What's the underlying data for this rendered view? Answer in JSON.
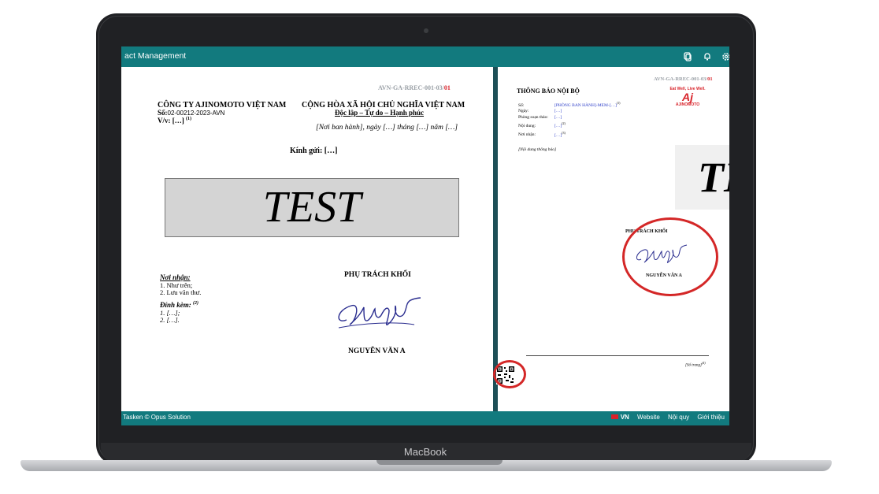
{
  "app": {
    "title": "act Management",
    "icons": [
      "copy-icon",
      "bell-icon",
      "gear-icon"
    ]
  },
  "footer": {
    "left": "Tasken © Opus Solution",
    "lang": "VN",
    "links": [
      "Website",
      "Nội quy",
      "Giới thiệu"
    ]
  },
  "laptop": {
    "brand": "MacBook"
  },
  "doc_left": {
    "code": "AVN-GA-RREC-001-03/",
    "code_suffix": "01",
    "company": "CÔNG TY AJINOMOTO VIỆT NAM",
    "so_label": "Số:",
    "so_value": "02-00212-2023-AVN",
    "vv": "V/v: […]",
    "vv_sup": "(1)",
    "republic": "CỘNG HÒA XÃ HỘI CHỦ NGHĨA VIỆT NAM",
    "motto": "Độc lập – Tự do – Hạnh phúc",
    "place_date": "[Nơi ban hành], ngày […] tháng […] năm […]",
    "greeting": "Kính gửi: […]",
    "watermark": "TEST",
    "recipients_label": "Nơi nhận:",
    "recipients": [
      "1.  Như trên;",
      "2.  Lưu văn thư."
    ],
    "attach_label": "Đính kèm:",
    "attach_sup": "(2)",
    "attachments": [
      "1.  […];",
      "2.  […]."
    ],
    "signer_title": "PHỤ TRÁCH KHỐI",
    "signer_name": "NGUYỄN VĂN A"
  },
  "doc_right": {
    "code": "AVN-GA-RREC-001-03/",
    "code_suffix": "01",
    "heading": "THÔNG BÁO NỘI BỘ",
    "logo_tagline": "Eat Well, Live Well.",
    "logo_brand": "AJINOMOTO",
    "fields": [
      {
        "label": "Số:",
        "value": "[PHÒNG BAN HÀNH]-MEM-[…]",
        "sup": "(1)"
      },
      {
        "label": "Ngày:",
        "value": "[…]",
        "sup": ""
      },
      {
        "label": "Phòng soạn thảo:",
        "value": "[…]",
        "sup": ""
      },
      {
        "label": "Nội dung:",
        "value": "[…]",
        "sup": "(2)"
      },
      {
        "label": "Nơi nhận:",
        "value": "[…]",
        "sup": "(3)"
      }
    ],
    "content_placeholder": "[Nội dung thông báo]",
    "watermark": "TEST",
    "signer_title": "PHỤ TRÁCH KHỐI",
    "signer_name": "NGUYỄN VĂN A",
    "page_number": "[Số trang]",
    "page_sup": "(4)"
  }
}
